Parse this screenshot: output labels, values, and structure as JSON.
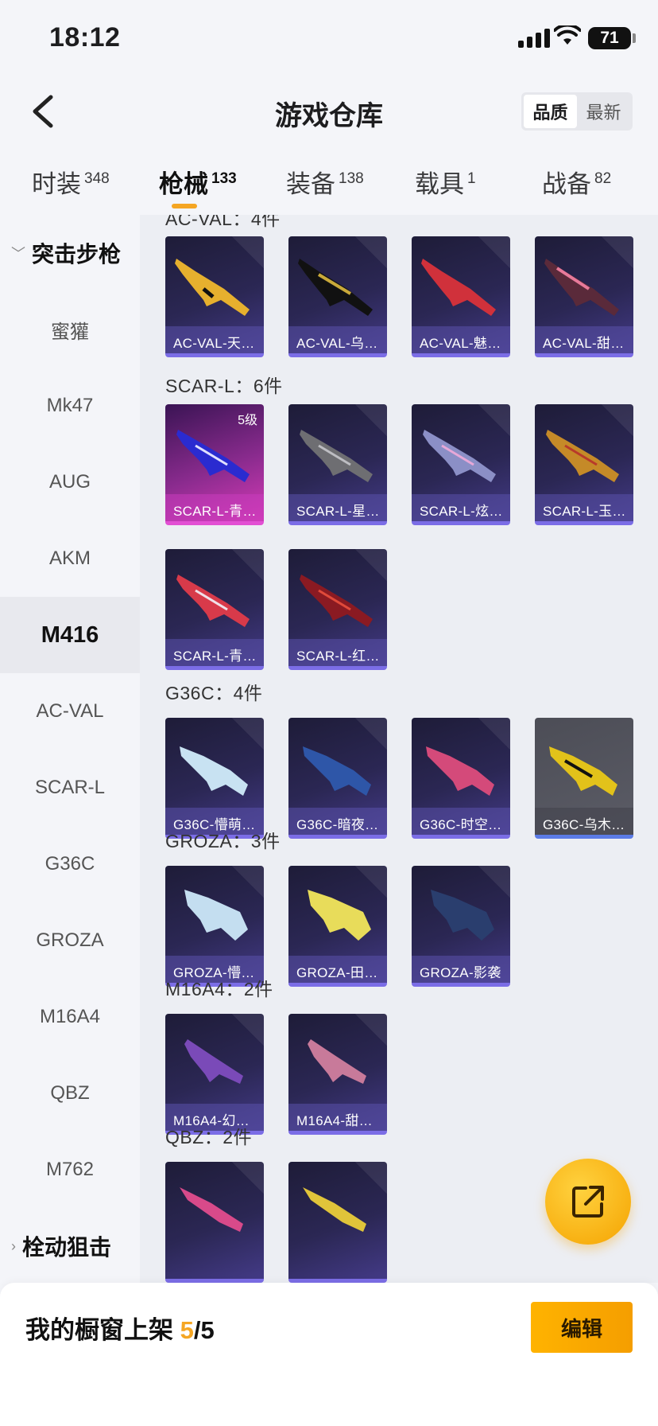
{
  "status_bar": {
    "time": "18:12",
    "battery": "71"
  },
  "header": {
    "title": "游戏仓库",
    "sort_options": [
      "品质",
      "最新"
    ]
  },
  "tabs": [
    {
      "label": "时装",
      "count": "348"
    },
    {
      "label": "枪械",
      "count": "133"
    },
    {
      "label": "装备",
      "count": "138"
    },
    {
      "label": "载具",
      "count": "1"
    },
    {
      "label": "战备",
      "count": "82"
    }
  ],
  "sidebar": {
    "group_open": "突击步枪",
    "items": [
      "蜜獾",
      "Mk47",
      "AUG",
      "AKM",
      "M416",
      "AC-VAL",
      "SCAR-L",
      "G36C",
      "GROZA",
      "M16A4",
      "QBZ",
      "M762"
    ],
    "selected": "M416",
    "group_closed": "栓动狙击"
  },
  "sections": [
    {
      "title": "AC-VAL：4件",
      "items": [
        "AC-VAL-天…",
        "AC-VAL-乌…",
        "AC-VAL-魅…",
        "AC-VAL-甜…"
      ]
    },
    {
      "title": "SCAR-L：6件",
      "items": [
        "SCAR-L-青…",
        "SCAR-L-星…",
        "SCAR-L-炫…",
        "SCAR-L-玉…",
        "SCAR-L-青…",
        "SCAR-L-红…"
      ],
      "level_badge": "5级"
    },
    {
      "title": "G36C：4件",
      "items": [
        "G36C-懵萌…",
        "G36C-暗夜…",
        "G36C-时空…",
        "G36C-乌木…"
      ]
    },
    {
      "title": "GROZA：3件",
      "items": [
        "GROZA-懵…",
        "GROZA-田…",
        "GROZA-影袭"
      ]
    },
    {
      "title": "M16A4：2件",
      "items": [
        "M16A4-幻…",
        "M16A4-甜…"
      ]
    },
    {
      "title": "QBZ：2件",
      "items": []
    }
  ],
  "bottom_bar": {
    "label": "我的橱窗上架 ",
    "count": "5",
    "total": "/5",
    "edit_label": "编辑"
  },
  "colors": {
    "accent": "#f5a623",
    "card_purple": "#433a86",
    "card_pink": "#d63bb6"
  }
}
